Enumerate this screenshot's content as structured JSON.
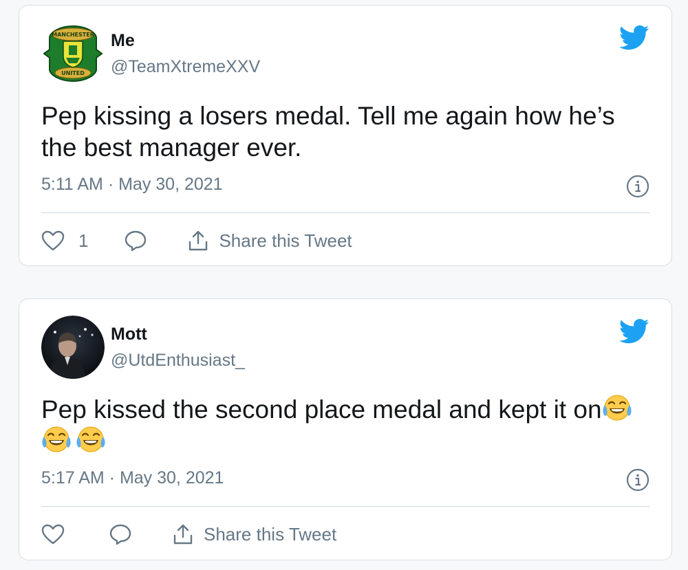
{
  "tweets": [
    {
      "name": "Me",
      "handle": "@TeamXtremeXXV",
      "text": "Pep kissing a losers medal. Tell me again how he’s the best manager ever.",
      "time": "5:11 AM · May 30, 2021",
      "like_count": "1",
      "share_label": "Share this Tweet",
      "avatar_icon": "manchester-united-crest",
      "avatar_crest_text": [
        "MANCHESTER",
        "UNITED"
      ]
    },
    {
      "name": "Mott",
      "handle": "@UtdEnthusiast_",
      "text": "Pep kissed the second place medal and kept it on",
      "emojis": [
        "face-with-tears-of-joy",
        "face-with-tears-of-joy",
        "face-with-tears-of-joy"
      ],
      "time": "5:17 AM · May 30, 2021",
      "like_count": "",
      "share_label": "Share this Tweet",
      "avatar_icon": "user-photo"
    }
  ],
  "colors": {
    "brand": "#1da1f2",
    "text": "#14171a",
    "secondary": "#657786",
    "border": "#ccd6dd",
    "emoji": "#ffcc4d"
  }
}
